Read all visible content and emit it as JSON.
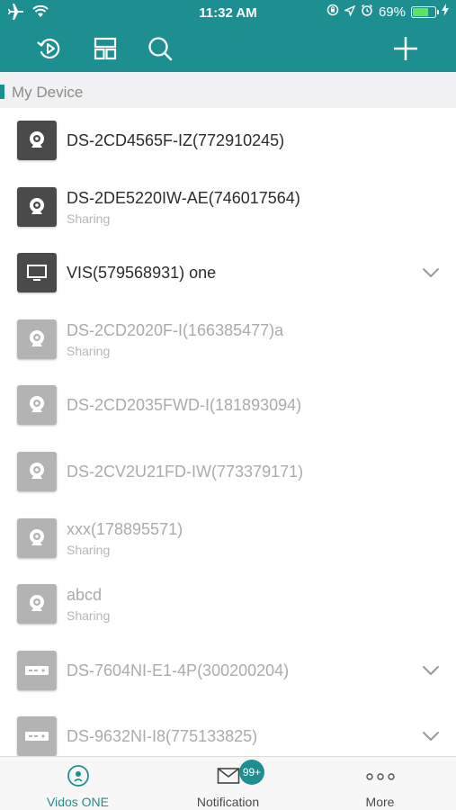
{
  "status_bar": {
    "time": "11:32 AM",
    "battery_text": "69%",
    "battery_level": 0.69,
    "icons": [
      "airplane-icon",
      "wifi-icon",
      "lock-rotation-icon",
      "location-icon",
      "alarm-icon",
      "charging-icon"
    ]
  },
  "toolbar": {
    "icons": [
      "playback-icon",
      "layout-icon",
      "search-icon",
      "add-icon"
    ]
  },
  "section": {
    "title": "My Device"
  },
  "devices": [
    {
      "name": "DS-2CD4565F-IZ(772910245)",
      "sub": "",
      "type": "camera",
      "online": true,
      "expandable": false
    },
    {
      "name": "DS-2DE5220IW-AE(746017564)",
      "sub": "Sharing",
      "type": "camera",
      "online": true,
      "expandable": false
    },
    {
      "name": "VIS(579568931) one",
      "sub": "",
      "type": "monitor",
      "online": true,
      "expandable": true
    },
    {
      "name": "DS-2CD2020F-I(166385477)a",
      "sub": "Sharing",
      "type": "camera",
      "online": false,
      "expandable": false
    },
    {
      "name": "DS-2CD2035FWD-I(181893094)",
      "sub": "",
      "type": "camera",
      "online": false,
      "expandable": false
    },
    {
      "name": "DS-2CV2U21FD-IW(773379171)",
      "sub": "",
      "type": "camera",
      "online": false,
      "expandable": false
    },
    {
      "name": "xxx(178895571)",
      "sub": "Sharing",
      "type": "camera",
      "online": false,
      "expandable": false
    },
    {
      "name": "abcd",
      "sub": "Sharing",
      "type": "camera",
      "online": false,
      "expandable": false
    },
    {
      "name": "DS-7604NI-E1-4P(300200204)",
      "sub": "",
      "type": "nvr",
      "online": false,
      "expandable": true
    },
    {
      "name": "DS-9632NI-I8(775133825)",
      "sub": "",
      "type": "nvr",
      "online": false,
      "expandable": true
    }
  ],
  "tabs": [
    {
      "label": "Vidos ONE",
      "icon": "device-tab-icon",
      "active": true
    },
    {
      "label": "Notification",
      "icon": "envelope-icon",
      "badge": "99+",
      "active": false
    },
    {
      "label": "More",
      "icon": "more-dots-icon",
      "active": false
    }
  ],
  "colors": {
    "accent": "#1e8f91",
    "online_text": "#2c2c2c",
    "offline_text": "#ababab"
  }
}
